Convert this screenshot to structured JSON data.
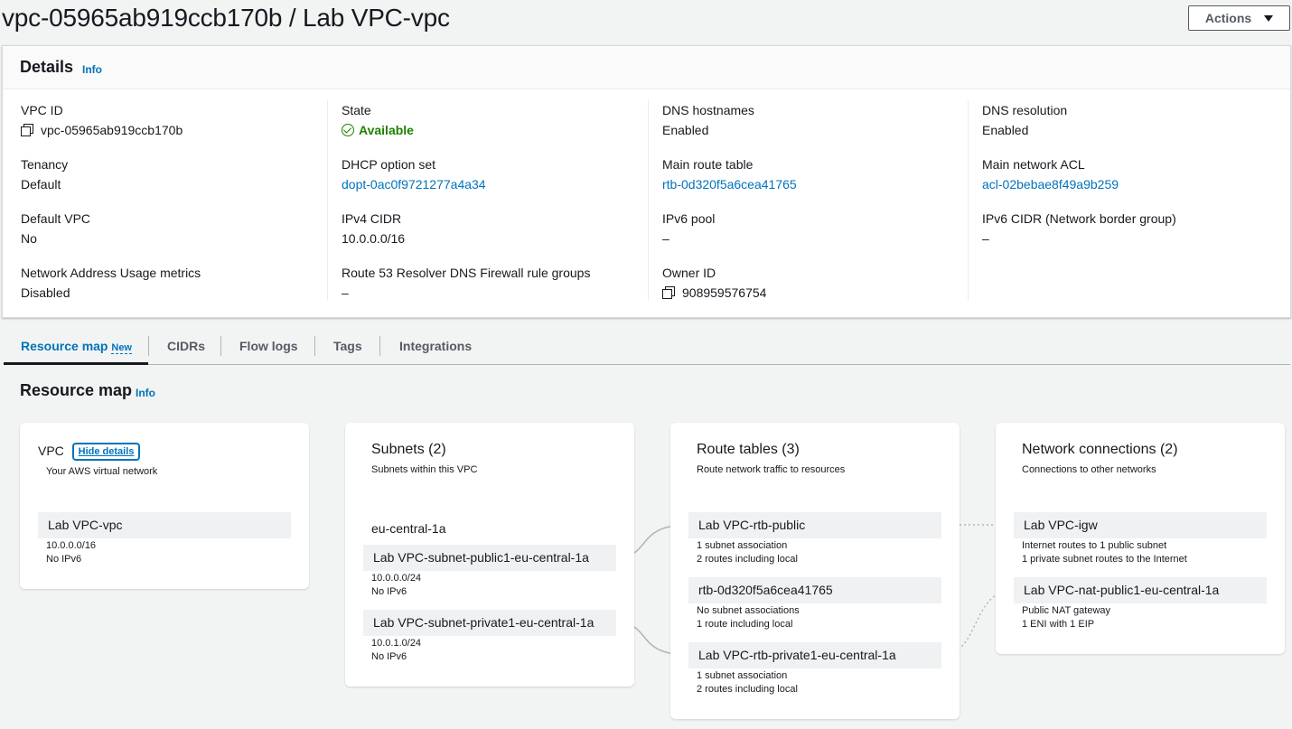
{
  "header": {
    "title": "vpc-05965ab919ccb170b / Lab VPC-vpc",
    "actions_label": "Actions"
  },
  "details": {
    "title": "Details",
    "info": "Info",
    "vpc_id_label": "VPC ID",
    "vpc_id_value": "vpc-05965ab919ccb170b",
    "state_label": "State",
    "state_value": "Available",
    "dns_hostnames_label": "DNS hostnames",
    "dns_hostnames_value": "Enabled",
    "dns_resolution_label": "DNS resolution",
    "dns_resolution_value": "Enabled",
    "tenancy_label": "Tenancy",
    "tenancy_value": "Default",
    "dhcp_label": "DHCP option set",
    "dhcp_value": "dopt-0ac0f9721277a4a34",
    "main_route_table_label": "Main route table",
    "main_route_table_value": "rtb-0d320f5a6cea41765",
    "main_acl_label": "Main network ACL",
    "main_acl_value": "acl-02bebae8f49a9b259",
    "default_vpc_label": "Default VPC",
    "default_vpc_value": "No",
    "ipv4_cidr_label": "IPv4 CIDR",
    "ipv4_cidr_value": "10.0.0.0/16",
    "ipv6_pool_label": "IPv6 pool",
    "ipv6_pool_value": "–",
    "ipv6_cidr_label": "IPv6 CIDR (Network border group)",
    "ipv6_cidr_value": "–",
    "nau_label": "Network Address Usage metrics",
    "nau_value": "Disabled",
    "r53_label": "Route 53 Resolver DNS Firewall rule groups",
    "r53_value": "–",
    "owner_label": "Owner ID",
    "owner_value": "908959576754"
  },
  "tabs": [
    {
      "label": "Resource map",
      "badge": "New"
    },
    {
      "label": "CIDRs"
    },
    {
      "label": "Flow logs"
    },
    {
      "label": "Tags"
    },
    {
      "label": "Integrations"
    }
  ],
  "resource_map": {
    "title": "Resource map",
    "info": "Info",
    "vpc": {
      "title": "VPC",
      "hide_details": "Hide details",
      "subtitle": "Your AWS virtual network",
      "node": "Lab VPC-vpc",
      "meta": [
        "10.0.0.0/16",
        "No IPv6"
      ]
    },
    "subnets": {
      "title": "Subnets (2)",
      "subtitle": "Subnets within this VPC",
      "az": "eu-central-1a",
      "items": [
        {
          "name": "Lab VPC-subnet-public1-eu-central-1a",
          "meta": [
            "10.0.0.0/24",
            "No IPv6"
          ]
        },
        {
          "name": "Lab VPC-subnet-private1-eu-central-1a",
          "meta": [
            "10.0.1.0/24",
            "No IPv6"
          ]
        }
      ]
    },
    "route_tables": {
      "title": "Route tables (3)",
      "subtitle": "Route network traffic to resources",
      "items": [
        {
          "name": "Lab VPC-rtb-public",
          "meta": [
            "1 subnet association",
            "2 routes including local"
          ]
        },
        {
          "name": "rtb-0d320f5a6cea41765",
          "meta": [
            "No subnet associations",
            "1 route including local"
          ]
        },
        {
          "name": "Lab VPC-rtb-private1-eu-central-1a",
          "meta": [
            "1 subnet association",
            "2 routes including local"
          ]
        }
      ]
    },
    "network_connections": {
      "title": "Network connections (2)",
      "subtitle": "Connections to other networks",
      "items": [
        {
          "name": "Lab VPC-igw",
          "meta": [
            "Internet routes to 1 public subnet",
            "1 private subnet routes to the Internet"
          ]
        },
        {
          "name": "Lab VPC-nat-public1-eu-central-1a",
          "meta": [
            "Public NAT gateway",
            "1 ENI with 1 EIP"
          ]
        }
      ]
    }
  }
}
